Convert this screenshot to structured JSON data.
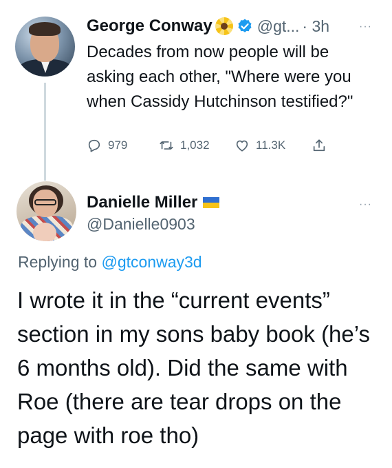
{
  "tweet1": {
    "name": "George Conway",
    "emoji_icon": "sunflower-icon",
    "verified_icon": "verified-badge-icon",
    "handle": "@gt...",
    "time": "· 3h",
    "more": "···",
    "text": "Decades from now people will be asking each other, \"Where were you when Cassidy Hutchinson testified?\"",
    "actions": {
      "replies": "979",
      "retweets": "1,032",
      "likes": "11.3K"
    }
  },
  "tweet2": {
    "name": "Danielle Miller",
    "flag_icon": "ukraine-flag-icon",
    "handle": "@Danielle0903",
    "more": "···",
    "replying_prefix": "Replying to",
    "replying_to": "@gtconway3d",
    "text": "I wrote it in the “current events” section in my sons baby book (he’s 6 months old). Did the same with Roe (there are tear drops on the page with roe tho)"
  },
  "colors": {
    "text": "#0f1419",
    "secondary": "#536471",
    "accent": "#1d9bf0",
    "verified": "#1d9bf0"
  }
}
